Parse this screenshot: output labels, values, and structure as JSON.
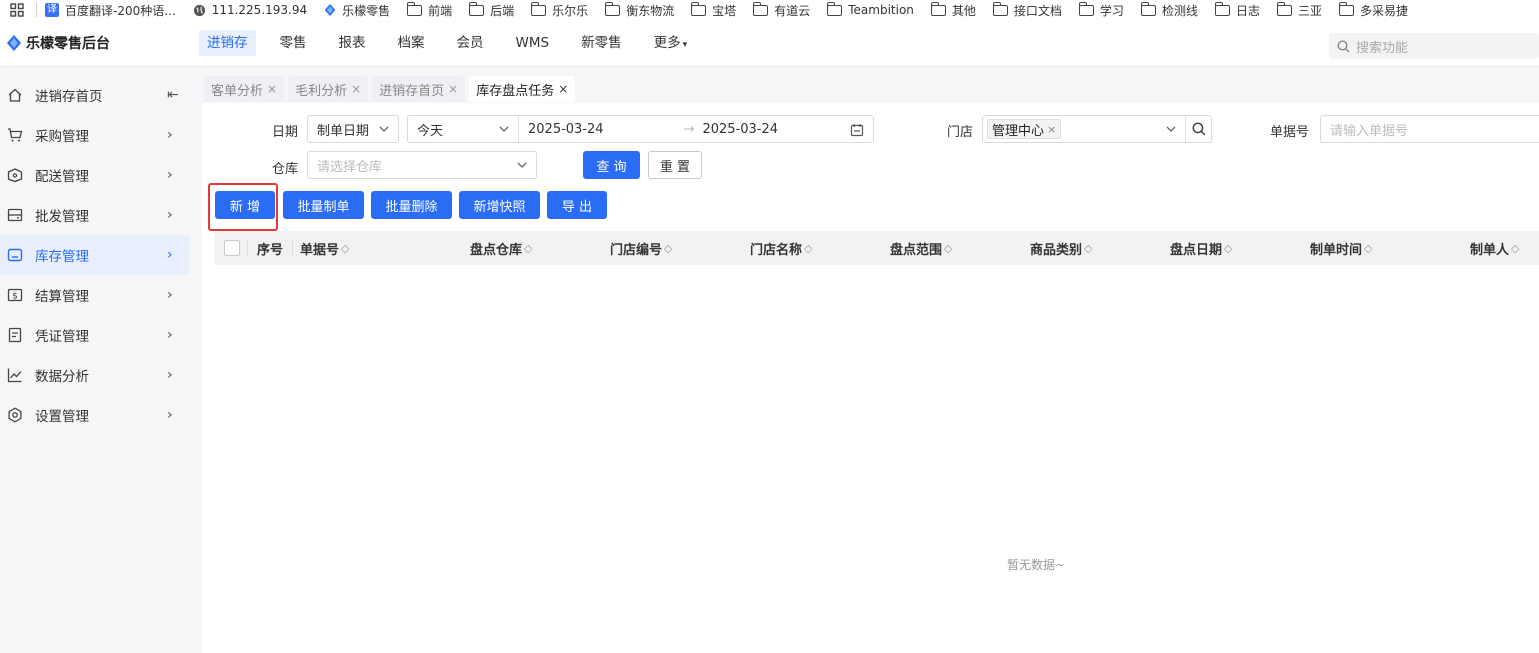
{
  "bookmarks": [
    {
      "label": "百度翻译-200种语...",
      "icon": "translate-icon"
    },
    {
      "label": "111.225.193.94",
      "icon": "globe-icon"
    },
    {
      "label": "乐檬零售",
      "icon": "lemeng-logo-icon"
    },
    {
      "label": "前端",
      "icon": "folder-icon"
    },
    {
      "label": "后端",
      "icon": "folder-icon"
    },
    {
      "label": "乐尔乐",
      "icon": "folder-icon"
    },
    {
      "label": "衡东物流",
      "icon": "folder-icon"
    },
    {
      "label": "宝塔",
      "icon": "folder-icon"
    },
    {
      "label": "有道云",
      "icon": "folder-icon"
    },
    {
      "label": "Teambition",
      "icon": "folder-icon"
    },
    {
      "label": "其他",
      "icon": "folder-icon"
    },
    {
      "label": "接口文档",
      "icon": "folder-icon"
    },
    {
      "label": "学习",
      "icon": "folder-icon"
    },
    {
      "label": "检测线",
      "icon": "folder-icon"
    },
    {
      "label": "日志",
      "icon": "folder-icon"
    },
    {
      "label": "三亚",
      "icon": "folder-icon"
    },
    {
      "label": "多采易捷",
      "icon": "folder-icon"
    }
  ],
  "translate_badge": "译",
  "app": {
    "title": "乐檬零售后台"
  },
  "topnav": [
    {
      "label": "进销存",
      "active": true
    },
    {
      "label": "零售"
    },
    {
      "label": "报表"
    },
    {
      "label": "档案"
    },
    {
      "label": "会员"
    },
    {
      "label": "WMS"
    },
    {
      "label": "新零售"
    },
    {
      "label": "更多",
      "caret": "▾"
    }
  ],
  "search": {
    "placeholder": "搜索功能"
  },
  "sidebar": {
    "items": [
      {
        "label": "进销存首页",
        "icon": "home-icon",
        "chevron": "⇤"
      },
      {
        "label": "采购管理",
        "icon": "cart-icon",
        "chevron": "›"
      },
      {
        "label": "配送管理",
        "icon": "delivery-icon",
        "chevron": "›"
      },
      {
        "label": "批发管理",
        "icon": "wholesale-icon",
        "chevron": "›"
      },
      {
        "label": "库存管理",
        "icon": "inventory-icon",
        "chevron": "›",
        "active": true
      },
      {
        "label": "结算管理",
        "icon": "settlement-icon",
        "chevron": "›"
      },
      {
        "label": "凭证管理",
        "icon": "voucher-icon",
        "chevron": "›"
      },
      {
        "label": "数据分析",
        "icon": "chart-icon",
        "chevron": "›"
      },
      {
        "label": "设置管理",
        "icon": "settings-icon",
        "chevron": "›"
      }
    ]
  },
  "tabs": [
    {
      "label": "客单分析",
      "close": "×"
    },
    {
      "label": "毛利分析",
      "close": "×"
    },
    {
      "label": "进销存首页",
      "close": "×"
    },
    {
      "label": "库存盘点任务",
      "close": "×",
      "active": true
    }
  ],
  "filters": {
    "date_label": "日期",
    "date_type": "制单日期",
    "date_range_preset": "今天",
    "date_start": "2025-03-24",
    "date_arrow": "→",
    "date_end": "2025-03-24",
    "store_label": "门店",
    "store_tag": "管理中心",
    "store_tag_close": "×",
    "doc_label": "单据号",
    "doc_placeholder": "请输入单据号",
    "warehouse_label": "仓库",
    "warehouse_placeholder": "请选择仓库",
    "query_button": "查 询",
    "reset_button": "重 置"
  },
  "actions": {
    "add": "新 增",
    "batch_create": "批量制单",
    "batch_delete": "批量删除",
    "add_snapshot": "新增快照",
    "export": "导 出"
  },
  "table": {
    "columns": [
      "序号",
      "单据号",
      "盘点仓库",
      "门店编号",
      "门店名称",
      "盘点范围",
      "商品类别",
      "盘点日期",
      "制单时间",
      "制单人"
    ],
    "sort_glyph": "◇",
    "empty_text": "暂无数据~"
  },
  "colors": {
    "accent": "#2a6df4",
    "highlight": "#e23a3a",
    "sidebar_bg": "#f5f6f8"
  }
}
